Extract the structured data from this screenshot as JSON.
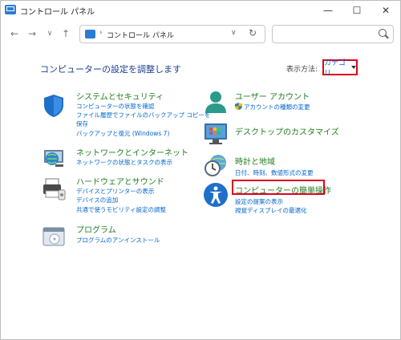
{
  "window": {
    "title": "コントロール パネル",
    "minimize_glyph": "—",
    "maximize_glyph": "☐",
    "close_glyph": "✕"
  },
  "nav": {
    "back": "←",
    "forward": "→",
    "recent": "∨",
    "up": "↑",
    "address_sep": "›",
    "address": "コントロール パネル",
    "address_dropdown": "∨",
    "refresh": "↻"
  },
  "main": {
    "heading": "コンピューターの設定を調整します",
    "view_by_label": "表示方法:",
    "view_by_value": "カテゴリ"
  },
  "left_categories": [
    {
      "title": "システムとセキュリティ",
      "links": [
        "コンピューターの状態を確認",
        "ファイル履歴でファイルのバックアップ コピーを",
        "保存",
        "バックアップと復元 (Windows 7)"
      ]
    },
    {
      "title": "ネットワークとインターネット",
      "links": [
        "ネットワークの状態とタスクの表示"
      ]
    },
    {
      "title": "ハードウェアとサウンド",
      "links": [
        "デバイスとプリンターの表示",
        "デバイスの追加",
        "共通で使うモビリティ設定の調整"
      ]
    },
    {
      "title": "プログラム",
      "links": [
        "プログラムのアンインストール"
      ]
    }
  ],
  "right_categories": [
    {
      "title": "ユーザー アカウント",
      "links": [
        "アカウントの種類の変更"
      ]
    },
    {
      "title": "デスクトップのカスタマイズ",
      "links": []
    },
    {
      "title": "時計と地域",
      "links": [
        "日付、時刻、数値形式の変更"
      ]
    },
    {
      "title": "コンピューターの簡単操作",
      "links": [
        "設定の提案の表示",
        "視覚ディスプレイの最適化"
      ]
    }
  ],
  "colors": {
    "accent": "#0066cc",
    "category_green": "#1f7d1f",
    "highlight_red": "#e0001b"
  }
}
